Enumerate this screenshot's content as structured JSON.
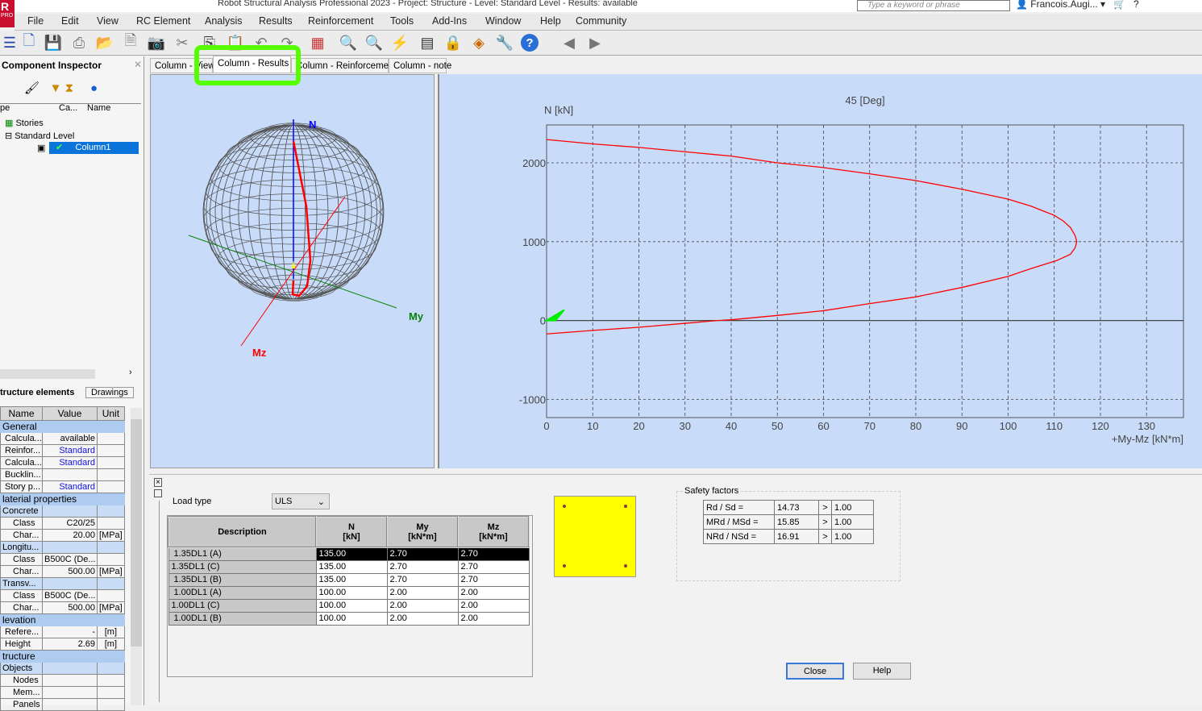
{
  "app": {
    "title": "Robot Structural Analysis Professional 2023 - Project: Structure - Level: Standard Level - Results: available",
    "logo": "R",
    "logo_sub": "PRO",
    "search_placeholder": "Type a keyword or phrase",
    "user": "Francois.Augi..."
  },
  "menu": [
    "File",
    "Edit",
    "View",
    "RC Element",
    "Analysis",
    "Results",
    "Reinforcement",
    "Tools",
    "Add-Ins",
    "Window",
    "Help",
    "Community"
  ],
  "inspector": {
    "title": "Component Inspector",
    "columns": [
      "pe",
      "Ca...",
      "Name"
    ],
    "tree": {
      "stories": "Stories",
      "level": "Standard Level",
      "column": "Column1"
    },
    "tabs": [
      "tructure elements",
      "Drawings"
    ]
  },
  "properties": {
    "headers": [
      "Name",
      "Value",
      "Unit"
    ],
    "rows": [
      {
        "type": "sec",
        "name": "General"
      },
      {
        "name": "Calcula...",
        "value": "available",
        "unit": ""
      },
      {
        "name": "Reinfor...",
        "value": "Standard",
        "unit": "",
        "link": true
      },
      {
        "name": "Calcula...",
        "value": "Standard",
        "unit": "",
        "link": true
      },
      {
        "name": "Bucklin...",
        "value": "",
        "unit": ""
      },
      {
        "name": "Story p...",
        "value": "Standard",
        "unit": "",
        "link": true
      },
      {
        "type": "sec",
        "name": "laterial properties"
      },
      {
        "type": "sub",
        "name": "Concrete"
      },
      {
        "name": "Class",
        "value": "C20/25",
        "unit": "",
        "indent": true
      },
      {
        "name": "Char...",
        "value": "20.00",
        "unit": "[MPa]",
        "indent": true
      },
      {
        "type": "sub",
        "name": "Longitu..."
      },
      {
        "name": "Class",
        "value": "B500C (De...",
        "unit": "",
        "indent": true
      },
      {
        "name": "Char...",
        "value": "500.00",
        "unit": "[MPa]",
        "indent": true
      },
      {
        "type": "sub",
        "name": "Transv..."
      },
      {
        "name": "Class",
        "value": "B500C (De...",
        "unit": "",
        "indent": true
      },
      {
        "name": "Char...",
        "value": "500.00",
        "unit": "[MPa]",
        "indent": true
      },
      {
        "type": "sec",
        "name": "levation"
      },
      {
        "name": "Refere...",
        "value": "-",
        "unit": "[m]"
      },
      {
        "name": "Height",
        "value": "2.69",
        "unit": "[m]"
      },
      {
        "type": "sec",
        "name": "tructure"
      },
      {
        "type": "sub",
        "name": "Objects"
      },
      {
        "name": "Nodes",
        "value": "",
        "unit": "",
        "indent": true
      },
      {
        "name": "Mem...",
        "value": "",
        "unit": "",
        "indent": true
      },
      {
        "name": "Panels",
        "value": "",
        "unit": "",
        "indent": true
      }
    ]
  },
  "doc_tabs": [
    "Column - View",
    "Column - Results",
    "Column - Reinforcement",
    "Column - note"
  ],
  "active_tab": 1,
  "highlight_color": "#55ff00",
  "view3d": {
    "axis_n": "N",
    "axis_my": "My",
    "axis_mz": "Mz"
  },
  "chart_data": {
    "type": "line",
    "title": "45 [Deg]",
    "xlabel": "+My-Mz [kN*m]",
    "ylabel": "N [kN]",
    "xlim": [
      0,
      138
    ],
    "ylim": [
      -1230,
      2480
    ],
    "xticks": [
      0,
      10,
      20,
      30,
      40,
      50,
      60,
      70,
      80,
      90,
      100,
      110,
      120,
      130
    ],
    "yticks": [
      -1000,
      0,
      1000,
      2000
    ],
    "grid": true,
    "series": [
      {
        "color": "#ff0000",
        "points": [
          [
            0,
            2295
          ],
          [
            10,
            2240
          ],
          [
            20,
            2195
          ],
          [
            30,
            2140
          ],
          [
            40,
            2085
          ],
          [
            50,
            2000
          ],
          [
            60,
            1940
          ],
          [
            70,
            1860
          ],
          [
            80,
            1775
          ],
          [
            90,
            1665
          ],
          [
            100,
            1540
          ],
          [
            105,
            1450
          ],
          [
            108,
            1380
          ],
          [
            110,
            1335
          ],
          [
            112,
            1260
          ],
          [
            113.5,
            1180
          ],
          [
            114.5,
            1080
          ],
          [
            114.9,
            1000
          ],
          [
            114.5,
            920
          ],
          [
            113.5,
            840
          ],
          [
            110.5,
            760
          ],
          [
            105,
            660
          ],
          [
            100,
            560
          ],
          [
            90,
            420
          ],
          [
            80,
            300
          ],
          [
            70,
            215
          ],
          [
            60,
            125
          ],
          [
            50,
            65
          ],
          [
            40,
            10
          ],
          [
            37,
            0
          ],
          [
            30,
            -35
          ],
          [
            20,
            -85
          ],
          [
            10,
            -125
          ],
          [
            0,
            -170
          ]
        ]
      }
    ],
    "load_point": {
      "color": "#00ee00",
      "x": 3.8,
      "y": 135
    }
  },
  "bottom": {
    "load_type_label": "Load type",
    "load_type_value": "ULS",
    "table_headers": [
      [
        "Description",
        ""
      ],
      [
        "N",
        "[kN]"
      ],
      [
        "My",
        "[kN*m]"
      ],
      [
        "Mz",
        "[kN*m]"
      ]
    ],
    "rows": [
      [
        "1.35DL1 (A)",
        "135.00",
        "2.70",
        "2.70"
      ],
      [
        "1.35DL1 (C)",
        "135.00",
        "2.70",
        "2.70"
      ],
      [
        "1.35DL1 (B)",
        "135.00",
        "2.70",
        "2.70"
      ],
      [
        "1.00DL1 (A)",
        "100.00",
        "2.00",
        "2.00"
      ],
      [
        "1.00DL1 (C)",
        "100.00",
        "2.00",
        "2.00"
      ],
      [
        "1.00DL1 (B)",
        "100.00",
        "2.00",
        "2.00"
      ]
    ],
    "selected_row": 0,
    "safety_title": "Safety factors",
    "safety": [
      [
        "Rd / Sd =",
        "14.73",
        ">",
        "1.00"
      ],
      [
        "MRd / MSd =",
        "15.85",
        ">",
        "1.00"
      ],
      [
        "NRd / NSd =",
        "16.91",
        ">",
        "1.00"
      ]
    ],
    "close_label": "Close",
    "help_label": "Help",
    "section_color": "#ffff00"
  }
}
